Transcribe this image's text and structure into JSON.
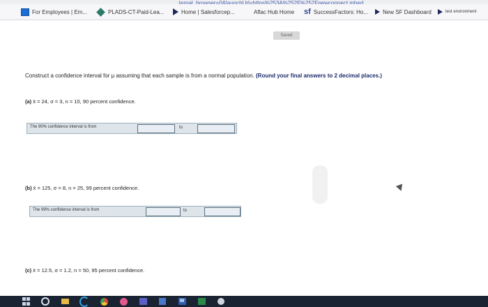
{
  "browser": {
    "url_fragment": "...ternal_browser=0&launchUrl=https%253A%252F%252Fnewconnect.mhed",
    "bookmarks": [
      {
        "label": "For Employees | Em...",
        "icon": "windows-icon"
      },
      {
        "label": "PLADS-CT-Paid-Lea...",
        "icon": "diamond-icon"
      },
      {
        "label": "Home | Salesforcep...",
        "icon": "play-icon"
      },
      {
        "label": "Aflac Hub Home",
        "icon": "grid-icon"
      },
      {
        "label": "SuccessFactors: Ho...",
        "icon": "sf-icon"
      },
      {
        "label": "New SF Dashboard",
        "icon": "play-icon"
      },
      {
        "label": "test environment",
        "icon": "play-icon"
      }
    ]
  },
  "page": {
    "saved_label": "Saved",
    "question_intro": "Construct a confidence interval for μ assuming that each sample is from a normal population.",
    "question_instruction": "(Round your final answers to 2 decimal places.)",
    "parts": [
      {
        "letter": "(a)",
        "text": "x̄ = 24, σ = 3, n = 10, 90 percent confidence.",
        "answer_label": "The 90% confidence interval is from",
        "to_label": "to",
        "lower_value": "",
        "upper_value": ""
      },
      {
        "letter": "(b)",
        "text": "x̄ = 125, σ = 8, n = 25, 99 percent confidence.",
        "answer_label": "The 99% confidence interval is from",
        "to_label": "to",
        "lower_value": "",
        "upper_value": ""
      },
      {
        "letter": "(c)",
        "text": "x̄ = 12.5, σ = 1.2, n = 50, 95 percent confidence."
      }
    ]
  },
  "colors": {
    "instruction_blue": "#1a2a6a",
    "answer_row_bg": "#dde4ea",
    "taskbar_bg": "#1a2331"
  }
}
